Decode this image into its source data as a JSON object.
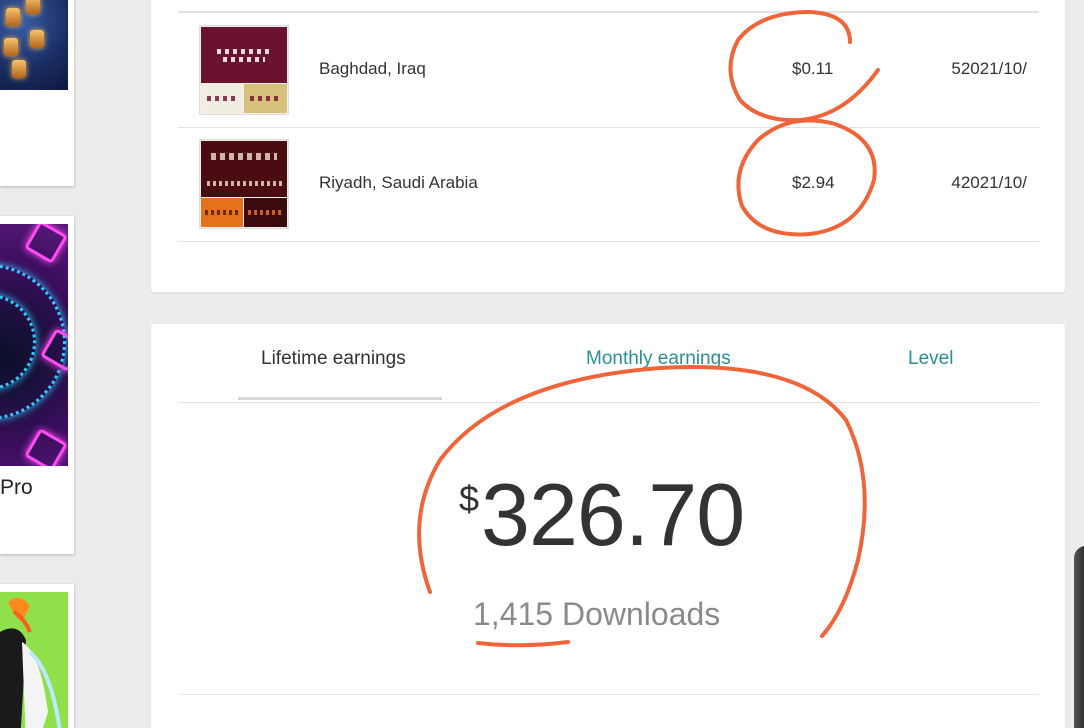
{
  "left_strip": {
    "card_text": "Pro"
  },
  "sales": [
    {
      "location": "Baghdad, Iraq",
      "amount": "$0.11",
      "date": "52021/10/",
      "thumb_color": "#6b1230",
      "thumb_bl": "#f1ede2",
      "thumb_br": "#d6c17a"
    },
    {
      "location": "Riyadh, Saudi Arabia",
      "amount": "$2.94",
      "date": "42021/10/",
      "thumb_color": "#4a0c12",
      "thumb_bl": "#e6711d",
      "thumb_br": "#3a0a0e"
    }
  ],
  "earnings": {
    "tabs": {
      "lifetime": "Lifetime earnings",
      "monthly": "Monthly earnings",
      "level": "Level"
    },
    "currency": "$",
    "total": "326.70",
    "downloads_count": "1,415",
    "downloads_label": "Downloads"
  },
  "colors": {
    "accent": "#2a8f94",
    "annotation": "#f0643a"
  }
}
